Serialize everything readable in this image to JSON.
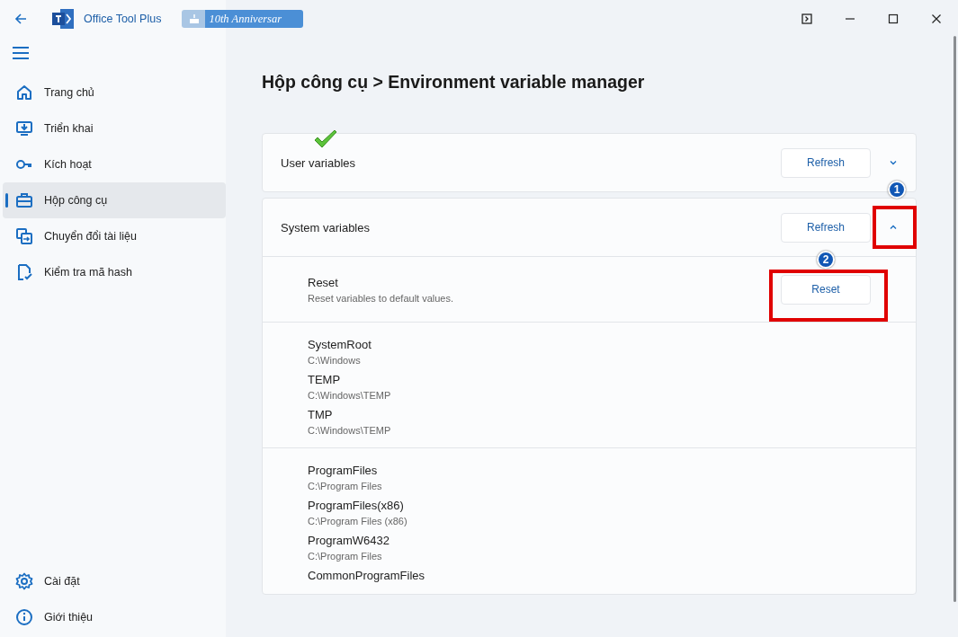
{
  "window": {
    "app_name": "Office Tool Plus",
    "badge": "10th Anniversar"
  },
  "sidebar": {
    "items": [
      {
        "label": "Trang chủ",
        "selected": false
      },
      {
        "label": "Triển khai",
        "selected": false
      },
      {
        "label": "Kích hoạt",
        "selected": false
      },
      {
        "label": "Hộp công cụ",
        "selected": true
      },
      {
        "label": "Chuyển đổi tài liệu",
        "selected": false
      },
      {
        "label": "Kiểm tra mã hash",
        "selected": false
      }
    ],
    "footer_items": [
      {
        "label": "Cài đặt",
        "selected": false
      },
      {
        "label": "Giới thiệu",
        "selected": false
      }
    ]
  },
  "page_title": "Hộp công cụ > Environment variable manager",
  "cards": [
    {
      "title": "User variables",
      "button": "Refresh",
      "expanded": false
    },
    {
      "title": "System variables",
      "button": "Refresh",
      "expanded": true,
      "reset": {
        "title": "Reset",
        "description": "Reset variables to default values.",
        "button": "Reset"
      },
      "groups": [
        [
          {
            "name": "SystemRoot",
            "value": "C:\\Windows"
          },
          {
            "name": "TEMP",
            "value": "C:\\Windows\\TEMP"
          },
          {
            "name": "TMP",
            "value": "C:\\Windows\\TEMP"
          }
        ],
        [
          {
            "name": "ProgramFiles",
            "value": "C:\\Program Files"
          },
          {
            "name": "ProgramFiles(x86)",
            "value": "C:\\Program Files (x86)"
          },
          {
            "name": "ProgramW6432",
            "value": "C:\\Program Files"
          },
          {
            "name": "CommonProgramFiles"
          }
        ]
      ]
    }
  ],
  "annotations": [
    {
      "kind": "check"
    },
    {
      "kind": "step",
      "text": "1"
    },
    {
      "kind": "step",
      "text": "2"
    },
    {
      "kind": "frame"
    },
    {
      "kind": "frame"
    }
  ]
}
